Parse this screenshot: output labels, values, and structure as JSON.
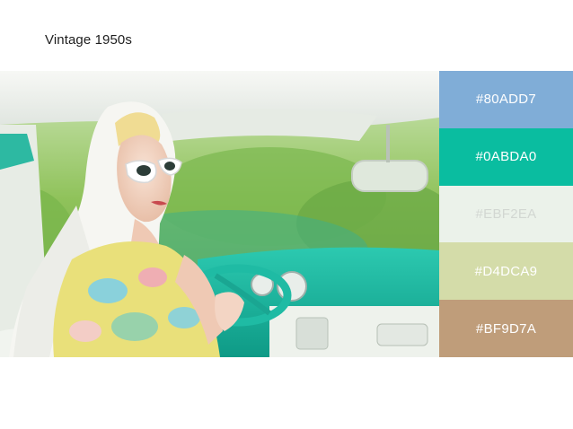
{
  "page": {
    "title": "Vintage 1950s"
  },
  "palette": [
    {
      "hex": "#80ADD7",
      "color": "#80ADD7",
      "label_color": "#FFFFFF"
    },
    {
      "hex": "#0ABDA0",
      "color": "#0ABDA0",
      "label_color": "#FFFFFF"
    },
    {
      "hex": "#EBF2EA",
      "color": "#EBF2EA",
      "label_color": "#D2D7D2"
    },
    {
      "hex": "#D4DCA9",
      "color": "#D4DCA9",
      "label_color": "#FFFFFF"
    },
    {
      "hex": "#BF9D7A",
      "color": "#BF9D7A",
      "label_color": "#FFFFFF"
    }
  ],
  "photo": {
    "subject": "woman-in-vintage-car-photo",
    "colors": {
      "sky_foliage": "#8fc25a",
      "dashboard": "#17b6a0",
      "interior_white": "#eef2ec",
      "headscarf": "#f6f6f2",
      "skin": "#f3d5c4",
      "dress_yellow": "#e9e07a",
      "dress_blue": "#7fcfe6"
    }
  }
}
